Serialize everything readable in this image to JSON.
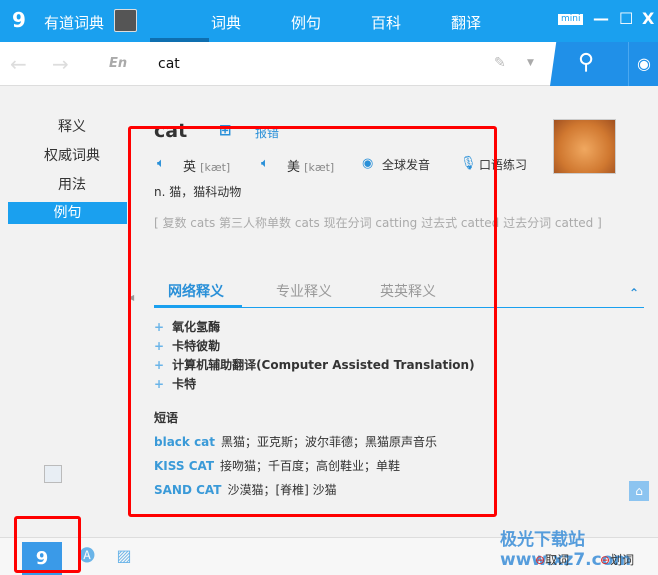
{
  "app": {
    "title": "有道词典",
    "nav": [
      "词典",
      "例句",
      "百科",
      "翻译"
    ],
    "selected_nav": "词典",
    "mini": "mini"
  },
  "search": {
    "lang": "En",
    "value": "cat"
  },
  "sidebar": {
    "items": [
      "释义",
      "权威词典",
      "用法",
      "例句"
    ],
    "selected": "例句"
  },
  "entry": {
    "word": "cat",
    "report": "报错",
    "uk_label": "英",
    "uk_phonetic": "[kæt]",
    "us_label": "美",
    "us_phonetic": "[kæt]",
    "global_pron": "全球发音",
    "oral_practice": "口语练习",
    "definition": "n. 猫，猫科动物",
    "forms": "[ 复数 cats 第三人称单数 cats 现在分词 catting 过去式 catted 过去分词 catted ]"
  },
  "tabs": [
    "网络释义",
    "专业释义",
    "英英释义"
  ],
  "web_defs": [
    "氧化氢酶",
    "卡特彼勒",
    "计算机辅助翻译(Computer Assisted Translation)",
    "卡特"
  ],
  "phrases_title": "短语",
  "phrases": [
    {
      "term": "black cat",
      "meaning": "黑猫；亚克斯；波尔菲德；黑猫原声音乐"
    },
    {
      "term": "KISS CAT",
      "meaning": "接吻猫；千百度；高创鞋业；单鞋"
    },
    {
      "term": "SAND CAT",
      "meaning": "沙漠猫；[脊椎] 沙猫"
    }
  ],
  "bottom": {
    "pick_word": "取词",
    "select_word": "划词"
  },
  "watermark": "极光下载站 www.xz7.com",
  "colors": {
    "accent": "#1aa0ef",
    "highlight_box": "#ff0000"
  }
}
